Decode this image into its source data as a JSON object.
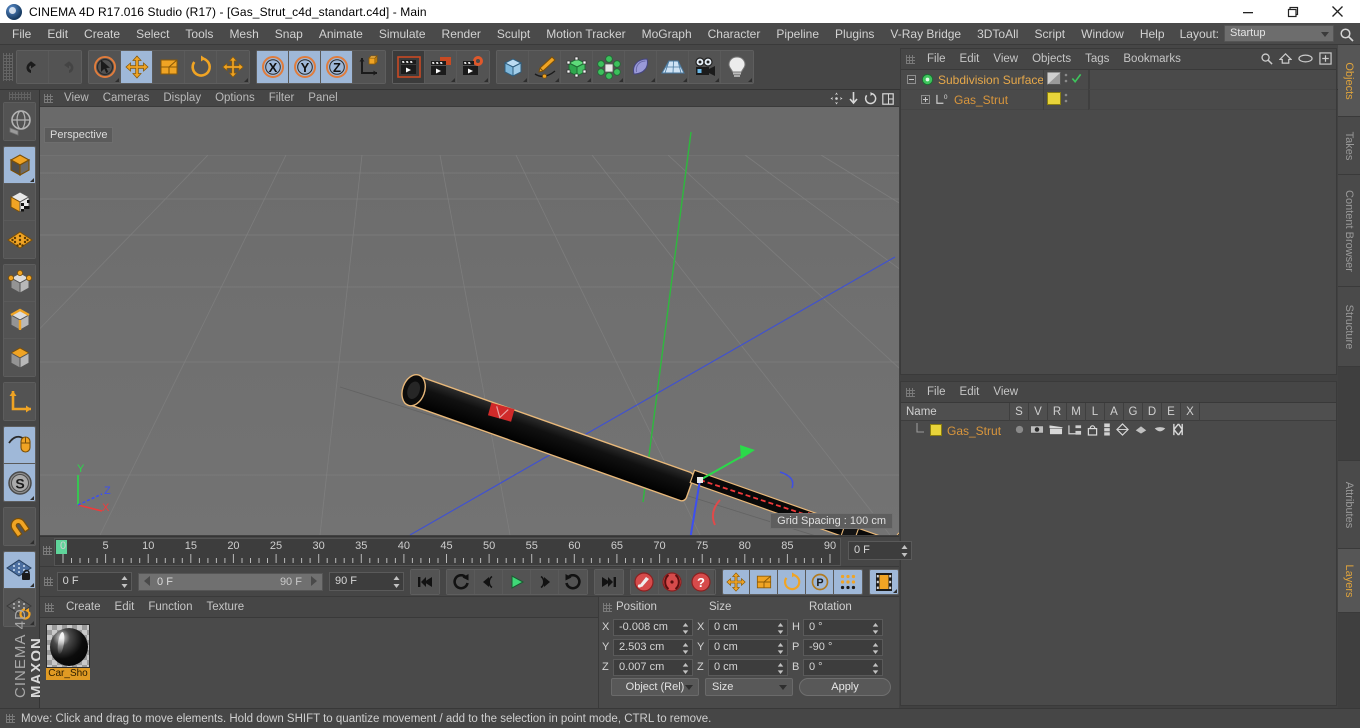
{
  "window": {
    "title": "CINEMA 4D R17.016 Studio (R17) - [Gas_Strut_c4d_standart.c4d] - Main",
    "app_icon": "cinema4d-logo-icon",
    "minimize": "minimize-icon",
    "maximize": "maximize-icon",
    "close": "close-icon"
  },
  "menubar": {
    "items": [
      "File",
      "Edit",
      "Create",
      "Select",
      "Tools",
      "Mesh",
      "Snap",
      "Animate",
      "Simulate",
      "Render",
      "Sculpt",
      "Motion Tracker",
      "MoGraph",
      "Character",
      "Pipeline",
      "Plugins",
      "V-Ray Bridge",
      "3DToAll",
      "Script",
      "Window",
      "Help"
    ],
    "layout_label": "Layout:",
    "layout_value": "Startup",
    "search_icon": "search-icon"
  },
  "toolbar": {
    "groups": [
      {
        "name": "undo-redo",
        "buttons": [
          {
            "icon": "undo-icon",
            "label": "Undo",
            "selected": false
          },
          {
            "icon": "redo-icon",
            "label": "Redo",
            "selected": false,
            "disabled": true
          }
        ]
      },
      {
        "name": "transform-tools",
        "buttons": [
          {
            "icon": "live-selection-icon",
            "label": "Live Selection",
            "selected": false,
            "corner": true
          },
          {
            "icon": "move-icon",
            "label": "Move",
            "selected": true
          },
          {
            "icon": "scale-icon",
            "label": "Scale",
            "selected": false
          },
          {
            "icon": "rotate-icon",
            "label": "Rotate",
            "selected": false
          },
          {
            "icon": "move-alt-icon",
            "label": "Move (alt)",
            "selected": false,
            "corner": true
          }
        ]
      },
      {
        "name": "axis-locks",
        "buttons": [
          {
            "icon": "axis-x-icon",
            "label": "X",
            "selected": true
          },
          {
            "icon": "axis-y-icon",
            "label": "Y",
            "selected": true
          },
          {
            "icon": "axis-z-icon",
            "label": "Z",
            "selected": true
          },
          {
            "icon": "world-object-axis-icon",
            "label": "World/Object",
            "selected": false
          }
        ]
      },
      {
        "name": "render-tools",
        "buttons": [
          {
            "icon": "render-view-icon",
            "label": "Render View",
            "selected": false
          },
          {
            "icon": "render-to-picture-viewer-icon",
            "label": "Render to Picture Viewer",
            "selected": false,
            "corner": true
          },
          {
            "icon": "render-settings-icon",
            "label": "Edit Render Settings",
            "selected": false,
            "corner": true
          }
        ]
      },
      {
        "name": "create-objects",
        "buttons": [
          {
            "icon": "cube-primitive-icon",
            "label": "Add Cube Object",
            "selected": false,
            "corner": true
          },
          {
            "icon": "spline-pen-icon",
            "label": "Add Spline",
            "selected": false,
            "corner": true
          },
          {
            "icon": "generator-icon",
            "label": "Add Generator",
            "selected": false,
            "corner": true
          },
          {
            "icon": "deformer-icon",
            "label": "Add Deformer",
            "selected": false,
            "corner": true
          },
          {
            "icon": "environment-icon",
            "label": "Add Scene Object",
            "selected": false,
            "corner": true
          },
          {
            "icon": "floor-icon",
            "label": "Add Floor",
            "selected": false,
            "corner": true
          },
          {
            "icon": "camera-icon",
            "label": "Add Camera",
            "selected": false,
            "corner": true
          },
          {
            "icon": "light-icon",
            "label": "Add Light",
            "selected": false,
            "corner": true
          }
        ]
      }
    ]
  },
  "lefttool": {
    "groups": [
      {
        "name": "undo-view-group",
        "buttons": [
          {
            "icon": "undo-view-icon",
            "label": "Undo View",
            "selected": false
          }
        ]
      },
      {
        "name": "editor-modes",
        "buttons": [
          {
            "icon": "make-editable-icon",
            "label": "Make Editable",
            "selected": true,
            "corner": true
          },
          {
            "icon": "texture-axis-icon",
            "label": "Enable Axis Modification",
            "selected": false
          },
          {
            "icon": "texture-mode-icon",
            "label": "Texture Mode",
            "selected": false
          }
        ]
      },
      {
        "name": "component-modes",
        "buttons": [
          {
            "icon": "points-mode-icon",
            "label": "Points",
            "selected": false
          },
          {
            "icon": "edges-mode-icon",
            "label": "Edges",
            "selected": false
          },
          {
            "icon": "polygons-mode-icon",
            "label": "Polygons",
            "selected": false
          }
        ]
      },
      {
        "name": "axis-group",
        "buttons": [
          {
            "icon": "world-axis-icon",
            "label": "World Coordinate System",
            "selected": false
          }
        ]
      },
      {
        "name": "snap-group",
        "buttons": [
          {
            "icon": "viewport-solo-icon",
            "label": "Viewport Solo",
            "selected": true
          },
          {
            "icon": "enable-snap-icon",
            "label": "Enable Snapping",
            "selected": true,
            "corner": true
          }
        ]
      },
      {
        "name": "magnet-group",
        "buttons": [
          {
            "icon": "magnet-icon",
            "label": "Magnet",
            "selected": false,
            "corner": true
          }
        ]
      },
      {
        "name": "workplane-group",
        "buttons": [
          {
            "icon": "lock-workplane-icon",
            "label": "Lock Workplane",
            "selected": true,
            "corner": true
          },
          {
            "icon": "workplane-rotate-icon",
            "label": "Planar Workplane",
            "selected": false,
            "corner": true
          }
        ]
      }
    ],
    "brand_top": "MAXON",
    "brand_bottom": "CINEMA 4D"
  },
  "viewport": {
    "menus": [
      "View",
      "Cameras",
      "Display",
      "Options",
      "Filter",
      "Panel"
    ],
    "header_icons": [
      "move-camera-icon",
      "zoom-camera-icon",
      "rotate-camera-icon",
      "maximize-view-icon"
    ],
    "label": "Perspective",
    "grid_spacing": "Grid Spacing : 100 cm",
    "axis_gizmo": {
      "x": "X",
      "y": "Y",
      "z": "Z"
    },
    "colors": {
      "x_axis": "#e03c3c",
      "y_axis": "#3cc840",
      "z_axis": "#3c46e0",
      "selection_outline": "#e8b87a",
      "background": "#6f6f6f"
    }
  },
  "objectmanager": {
    "menus": [
      "File",
      "Edit",
      "View",
      "Objects",
      "Tags",
      "Bookmarks"
    ],
    "header_icons": [
      "search-icon",
      "home-icon",
      "link-icon",
      "new-tab-icon"
    ],
    "rows": [
      {
        "name": "Subdivision Surface",
        "icon": "subdivision-surface-icon",
        "indent": 0,
        "expanded": true,
        "tags": [
          "display-tag",
          "checkmark-enabled"
        ],
        "color": "#d9963c"
      },
      {
        "name": "Gas_Strut",
        "icon": "null-object-icon",
        "indent": 1,
        "expanded": false,
        "tags": [
          "yellow-material-tag"
        ],
        "color": "#d9963c"
      }
    ]
  },
  "attributemanager": {
    "menus": [
      "File",
      "Edit",
      "View"
    ],
    "columns": [
      "Name",
      "S",
      "V",
      "R",
      "M",
      "L",
      "A",
      "G",
      "D",
      "E",
      "X"
    ],
    "rows": [
      {
        "name": "Gas_Strut",
        "color": "#d9963c",
        "swatch": "#e8d43a"
      }
    ]
  },
  "vtabs_right": [
    {
      "label": "Objects",
      "active": true
    },
    {
      "label": "Takes",
      "active": false
    },
    {
      "label": "Content Browser",
      "active": false
    },
    {
      "label": "Structure",
      "active": false
    }
  ],
  "vtabs_right_lower": [
    {
      "label": "Attributes",
      "active": false
    },
    {
      "label": "Layers",
      "active": true
    }
  ],
  "timeline": {
    "ticks": [
      0,
      5,
      10,
      15,
      20,
      25,
      30,
      35,
      40,
      45,
      50,
      55,
      60,
      65,
      70,
      75,
      80,
      85,
      90
    ],
    "min": 0,
    "max": 90,
    "current_frame_field": "0 F",
    "playhead_frame": 0
  },
  "transport": {
    "current_frame": "0 F",
    "range_start": "0 F",
    "range_end": "90 F",
    "preview_end": "90 F",
    "buttons": [
      {
        "icon": "go-to-start-icon",
        "label": "Go to Start",
        "selected": false
      },
      {
        "icon": "play-backward-icon",
        "label": "Play Backwards",
        "selected": false
      },
      {
        "icon": "step-back-icon",
        "label": "Previous Frame",
        "selected": false
      },
      {
        "icon": "play-icon",
        "label": "Play Forwards",
        "selected": false
      },
      {
        "icon": "step-forward-icon",
        "label": "Next Frame",
        "selected": false
      },
      {
        "icon": "play-loop-icon",
        "label": "Loop",
        "selected": false
      },
      {
        "icon": "go-to-end-icon",
        "label": "Go to End",
        "selected": false
      },
      {
        "icon": "record-keyframe-icon",
        "label": "Record Active Objects",
        "selected": false
      },
      {
        "icon": "autokeying-icon",
        "label": "Autokeying",
        "selected": false
      },
      {
        "icon": "keyframe-selection-icon",
        "label": "Keyframe Selection",
        "selected": false
      },
      {
        "icon": "position-key-icon",
        "label": "Position",
        "selected": true
      },
      {
        "icon": "scale-key-icon",
        "label": "Scale",
        "selected": true
      },
      {
        "icon": "rotation-key-icon",
        "label": "Rotation",
        "selected": true
      },
      {
        "icon": "param-key-icon",
        "label": "Parameter",
        "selected": true
      },
      {
        "icon": "pla-key-icon",
        "label": "Point Level Animation",
        "selected": true
      },
      {
        "icon": "filmstrip-icon",
        "label": "Timeline",
        "selected": true
      }
    ]
  },
  "materialmanager": {
    "menus": [
      "Create",
      "Edit",
      "Function",
      "Texture"
    ],
    "materials": [
      {
        "name": "Car_Sho",
        "selected": true
      }
    ]
  },
  "coordinates": {
    "columns": [
      "Position",
      "Size",
      "Rotation"
    ],
    "rows": [
      {
        "pos_axis": "X",
        "pos_value": "-0.008 cm",
        "size_axis": "X",
        "size_value": "0 cm",
        "rot_axis": "H",
        "rot_value": "0 °"
      },
      {
        "pos_axis": "Y",
        "pos_value": "2.503 cm",
        "size_axis": "Y",
        "size_value": "0 cm",
        "rot_axis": "P",
        "rot_value": "-90 °"
      },
      {
        "pos_axis": "Z",
        "pos_value": "0.007 cm",
        "size_axis": "Z",
        "size_value": "0 cm",
        "rot_axis": "B",
        "rot_value": "0 °"
      }
    ],
    "mode_dropdown": "Object (Rel)",
    "size_dropdown": "Size",
    "apply_button": "Apply"
  },
  "statusbar": {
    "message": "Move: Click and drag to move elements. Hold down SHIFT to quantize movement / add to the selection in point mode, CTRL to remove."
  }
}
